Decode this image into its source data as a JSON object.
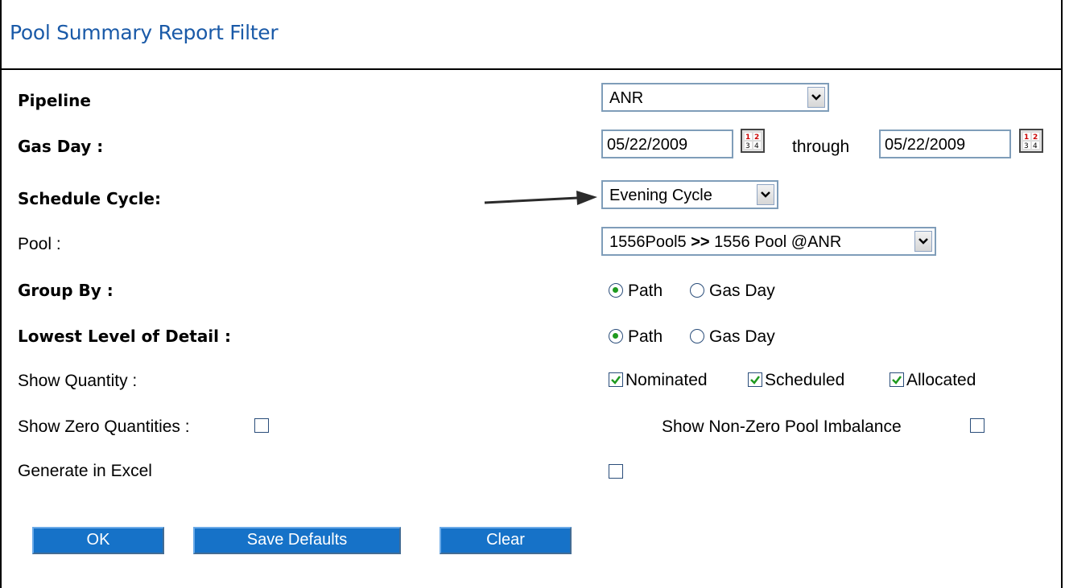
{
  "header": {
    "title": "Pool Summary Report Filter"
  },
  "fields": {
    "pipeline": {
      "label": "Pipeline",
      "value": "ANR"
    },
    "gas_day": {
      "label": "Gas Day :",
      "from": "05/22/2009",
      "through_label": "through",
      "to": "05/22/2009"
    },
    "schedule_cycle": {
      "label": "Schedule Cycle:",
      "value": "Evening Cycle"
    },
    "pool": {
      "label": "Pool :",
      "value_left": "1556Pool5",
      "separator": ">>",
      "value_right": "1556 Pool @ANR"
    },
    "group_by": {
      "label": "Group By :",
      "options": [
        "Path",
        "Gas Day"
      ],
      "selected": "Path"
    },
    "lowest_level": {
      "label": "Lowest Level of Detail :",
      "options": [
        "Path",
        "Gas Day"
      ],
      "selected": "Path"
    },
    "show_quantity": {
      "label": "Show Quantity :",
      "options": [
        {
          "label": "Nominated",
          "checked": true
        },
        {
          "label": "Scheduled",
          "checked": true
        },
        {
          "label": "Allocated",
          "checked": true
        }
      ]
    },
    "show_zero": {
      "label": "Show Zero Quantities :",
      "checked": false
    },
    "show_nonzero_imbalance": {
      "label": "Show Non-Zero Pool Imbalance",
      "checked": false
    },
    "generate_excel": {
      "label": "Generate in Excel",
      "checked": false
    }
  },
  "buttons": {
    "ok": "OK",
    "save_defaults": "Save Defaults",
    "clear": "Clear"
  },
  "colors": {
    "title": "#1a5aa8",
    "button_bg": "#1672c8",
    "radio_dot": "#1f9a1f"
  },
  "icons": {
    "calendar": "calendar-icon",
    "dropdown": "chevron-down-icon",
    "arrow": "annotation-arrow"
  }
}
